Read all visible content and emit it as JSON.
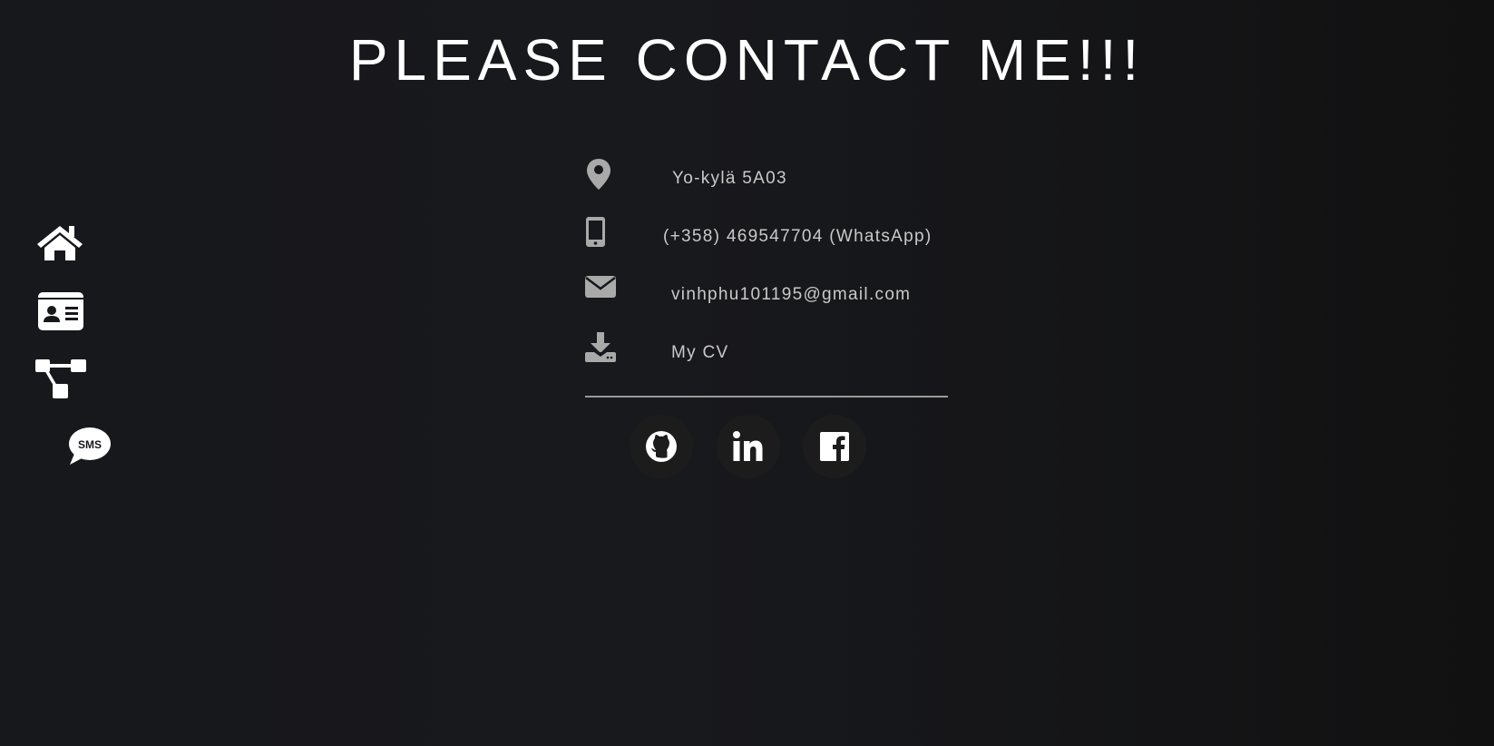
{
  "page": {
    "title": "PLEASE CONTACT ME!!!"
  },
  "nav": {
    "items": [
      {
        "icon": "home-icon"
      },
      {
        "icon": "id-card-icon"
      },
      {
        "icon": "project-diagram-icon"
      },
      {
        "icon": "sms-icon",
        "label": "SMS"
      }
    ]
  },
  "contact": {
    "address": {
      "icon": "location-pin-icon",
      "text": "Yo-kylä 5A03"
    },
    "phone": {
      "icon": "mobile-phone-icon",
      "text": "(+358) 469547704 (WhatsApp)"
    },
    "email": {
      "icon": "envelope-icon",
      "text": "vinhphu101195@gmail.com"
    },
    "cv": {
      "icon": "download-icon",
      "text": "My CV"
    }
  },
  "socials": [
    {
      "icon": "github-icon"
    },
    {
      "icon": "linkedin-icon"
    },
    {
      "icon": "facebook-icon"
    }
  ],
  "colors": {
    "background": "#17181c",
    "title": "#ffffff",
    "contact_text": "#c9c9c9",
    "contact_icon": "#a9a9a9",
    "nav_icon": "#ffffff",
    "divider": "#9a9a9a",
    "social_bg": "#1c1c1d"
  }
}
